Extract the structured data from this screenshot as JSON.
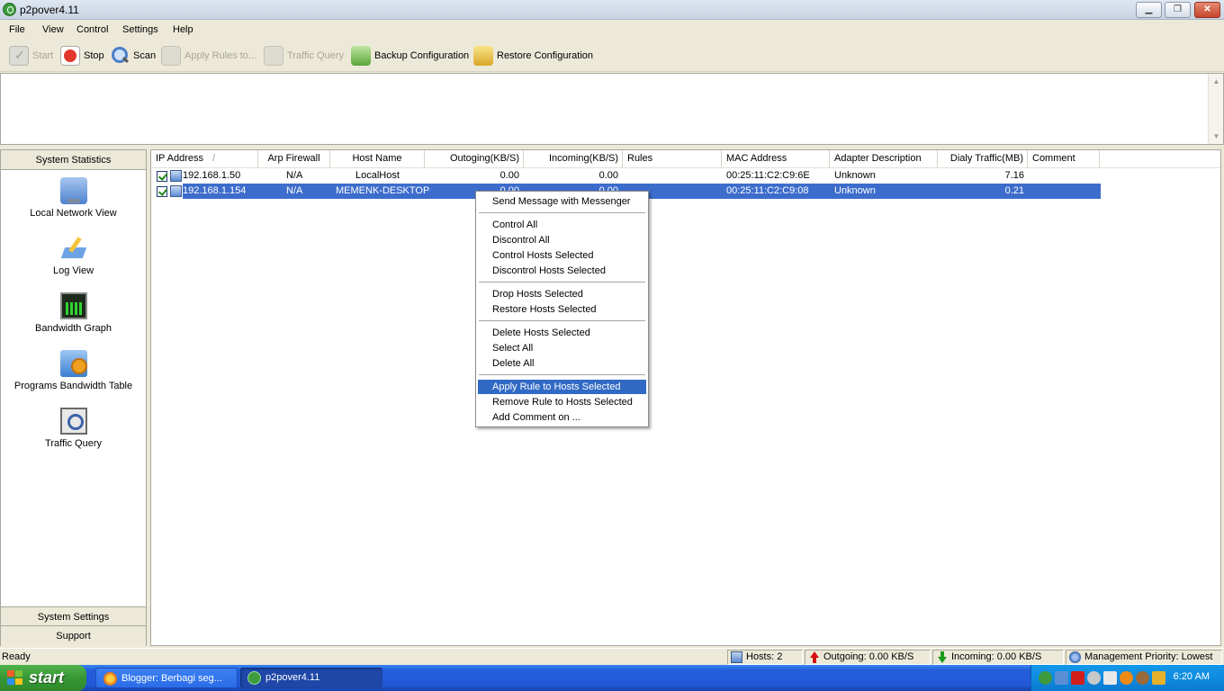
{
  "window": {
    "title": "p2pover4.11",
    "controls": {
      "minimize": "▁",
      "maximize": "❐",
      "close": "✕"
    }
  },
  "menu": [
    "File",
    "View",
    "Control",
    "Settings",
    "Help"
  ],
  "toolbar": {
    "start": "Start",
    "stop": "Stop",
    "scan": "Scan",
    "apply_rules": "Apply Rules to...",
    "traffic_query": "Traffic Query",
    "backup": "Backup Configuration",
    "restore": "Restore Configuration"
  },
  "sidebar": {
    "header": "System Statistics",
    "items": [
      {
        "label": "Local Network View",
        "icon": "network-icon"
      },
      {
        "label": "Log View",
        "icon": "log-icon"
      },
      {
        "label": "Bandwidth Graph",
        "icon": "bandwidth-icon"
      },
      {
        "label": "Programs Bandwidth Table",
        "icon": "programs-icon"
      },
      {
        "label": "Traffic Query",
        "icon": "traffic-query-icon"
      }
    ],
    "footer": [
      "System Settings",
      "Support"
    ]
  },
  "hosts": {
    "columns": [
      "IP Address",
      "Arp Firewall",
      "Host Name",
      "Outoging(KB/S)",
      "Incoming(KB/S)",
      "Rules",
      "MAC Address",
      "Adapter Description",
      "Dialy Traffic(MB)",
      "Comment"
    ],
    "sort_indicator": "/",
    "rows": [
      {
        "ip": "192.168.1.50",
        "arp": "N/A",
        "host": "LocalHost",
        "out": "0.00",
        "in": "0.00",
        "rules": "",
        "mac": "00:25:11:C2:C9:6E",
        "adapter": "Unknown",
        "traffic": "7.16",
        "comment": "",
        "checked": true,
        "selected": false
      },
      {
        "ip": "192.168.1.154",
        "arp": "N/A",
        "host": "MEMENK-DESKTOP",
        "out": "0.00",
        "in": "0.00",
        "rules": "",
        "mac": "00:25:11:C2:C9:08",
        "adapter": "Unknown",
        "traffic": "0.21",
        "comment": "",
        "checked": true,
        "selected": true
      }
    ]
  },
  "context_menu": {
    "groups": [
      [
        "Send Message with Messenger"
      ],
      [
        "Control All",
        "Discontrol All",
        "Control Hosts Selected",
        "Discontrol Hosts Selected"
      ],
      [
        "Drop Hosts Selected",
        "Restore Hosts Selected"
      ],
      [
        "Delete Hosts Selected",
        "Select All",
        "Delete All"
      ],
      [
        "Apply Rule to Hosts Selected",
        "Remove Rule to Hosts Selected",
        "Add Comment on ..."
      ]
    ],
    "highlighted": "Apply Rule to Hosts Selected"
  },
  "status": {
    "ready": "Ready",
    "hosts": "Hosts: 2",
    "outgoing": "Outgoing: 0.00 KB/S",
    "incoming": "Incoming: 0.00 KB/S",
    "management": "Management Priority: Lowest"
  },
  "taskbar": {
    "start": "start",
    "tasks": [
      {
        "label": "Blogger: Berbagi seg...",
        "active": false
      },
      {
        "label": "p2pover4.11",
        "active": true
      }
    ],
    "clock": "6:20 AM"
  },
  "colors": {
    "selection": "#3d6dcc",
    "menu_highlight": "#316ac5",
    "taskbar": "#245edb",
    "start": "#379734"
  }
}
